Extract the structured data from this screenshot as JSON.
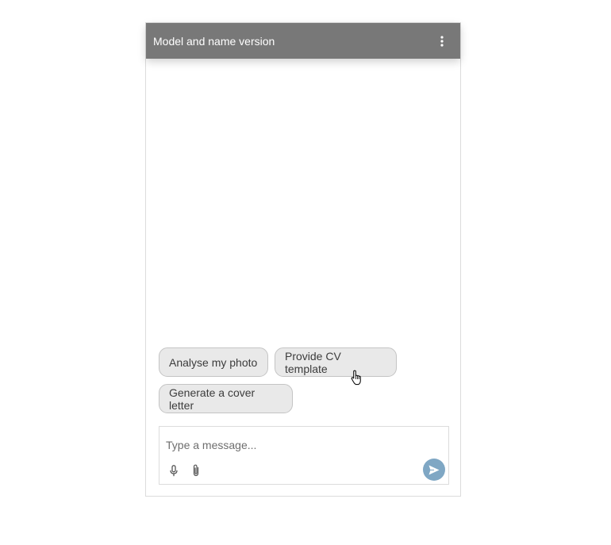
{
  "header": {
    "title": "Model and name version",
    "menu_icon": "more-vertical-icon",
    "background_color": "#787878"
  },
  "suggestions": [
    {
      "label": "Analyse my photo"
    },
    {
      "label": "Provide CV template"
    },
    {
      "label": "Generate a cover letter"
    }
  ],
  "composer": {
    "placeholder": "Type a message...",
    "value": "",
    "mic_icon": "microphone-icon",
    "attach_icon": "paperclip-icon",
    "send_icon": "send-icon",
    "send_color": "#7fa7c4"
  },
  "cursor": {
    "icon": "hand-pointer-cursor-icon"
  }
}
